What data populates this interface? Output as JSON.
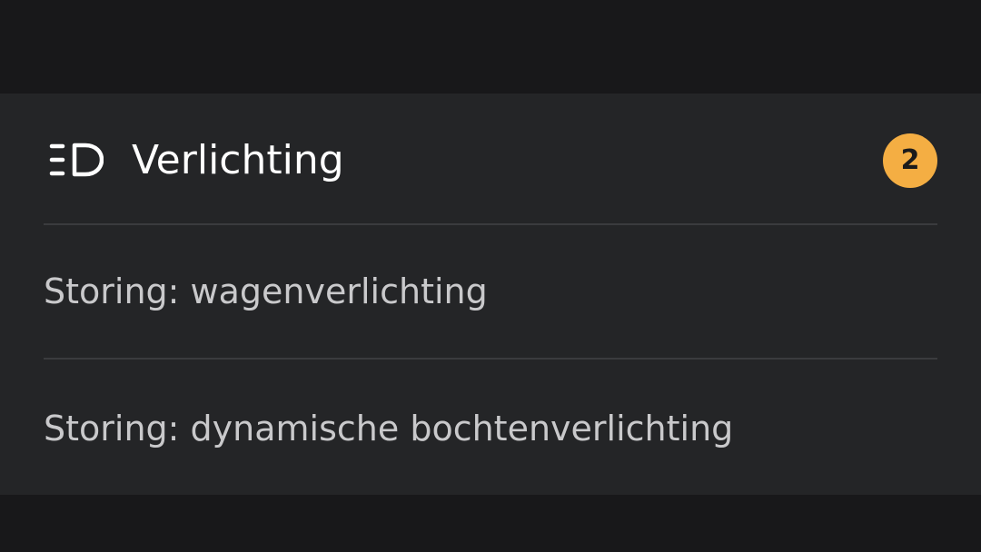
{
  "section": {
    "icon": "headlight-icon",
    "title": "Verlichting",
    "badge_count": "2",
    "badge_color": "#f4ae43",
    "items": [
      {
        "label": "Storing: wagenverlichting"
      },
      {
        "label": "Storing: dynamische bochtenverlichting"
      }
    ]
  }
}
